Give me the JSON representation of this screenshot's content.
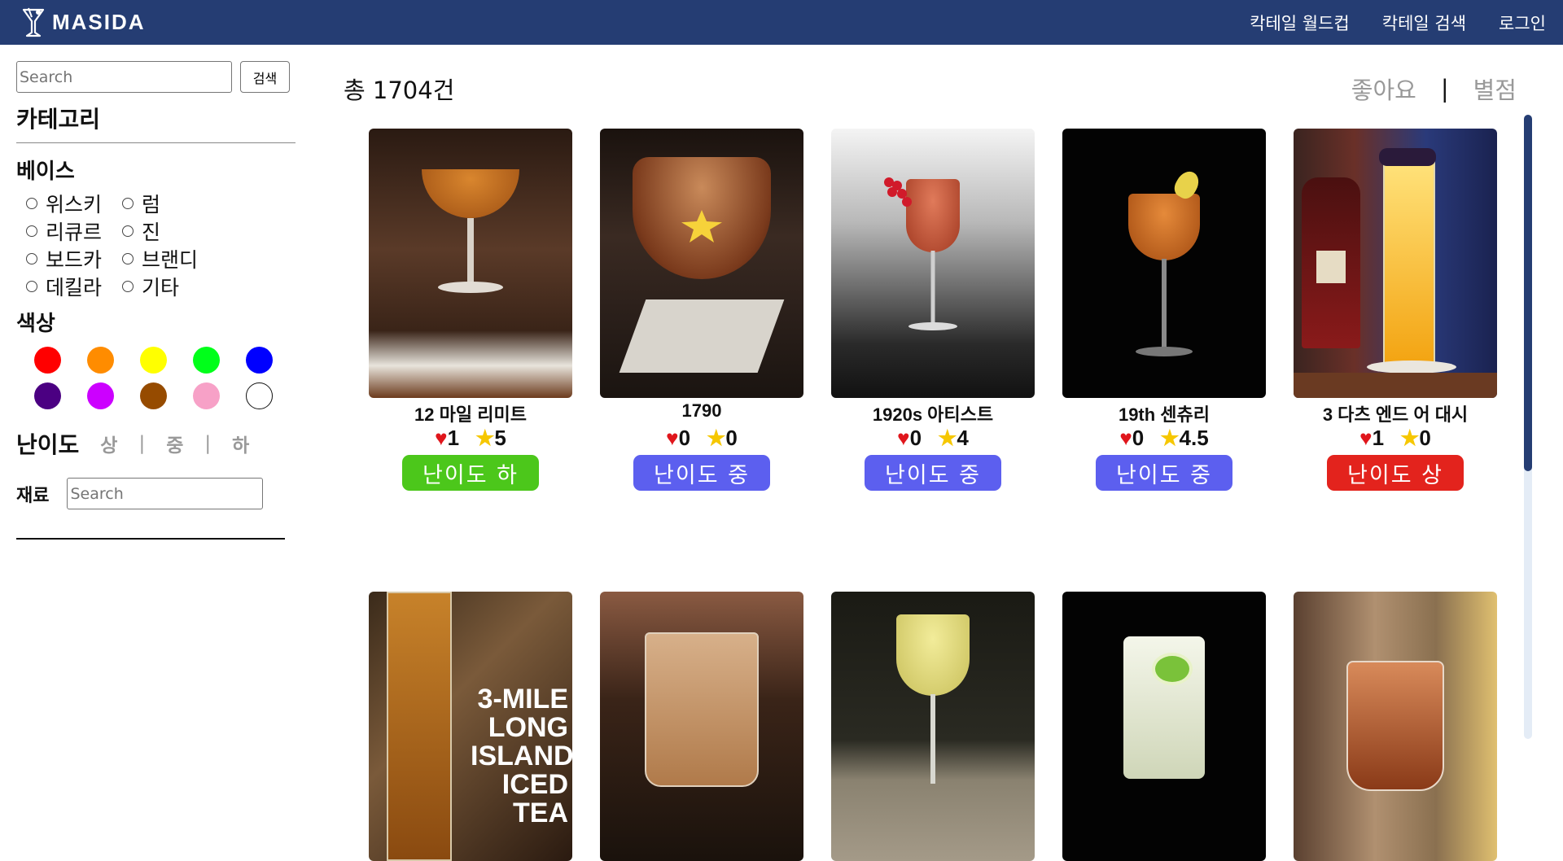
{
  "header": {
    "logo_text": "MASIDA",
    "nav": [
      "칵테일 월드컵",
      "칵테일 검색",
      "로그인"
    ]
  },
  "sidebar": {
    "search_placeholder": "Search",
    "search_button": "검색",
    "category_title": "카테고리",
    "base_title": "베이스",
    "bases": [
      "위스키",
      "럼",
      "리큐르",
      "진",
      "보드카",
      "브랜디",
      "데킬라",
      "기타"
    ],
    "color_title": "색상",
    "colors": [
      "#ff0000",
      "#ff8c00",
      "#ffff00",
      "#00ff1a",
      "#0000ff",
      "#4b0082",
      "#cc00ff",
      "#964b00",
      "#f7a1c7",
      "#ffffff"
    ],
    "difficulty_title": "난이도",
    "difficulty_options": [
      "상",
      "중",
      "하"
    ],
    "difficulty_sep": "|",
    "ingredient_label": "재료",
    "ingredient_placeholder": "Search"
  },
  "main": {
    "total_text": "총 1704건",
    "sort_options": [
      "좋아요",
      "별점"
    ],
    "sort_sep": "|",
    "cards": [
      {
        "name": "12 마일 리미트",
        "likes": "1",
        "rating": "5",
        "difficulty": "난이도 하",
        "difficulty_color": "#4cc71b"
      },
      {
        "name": "1790",
        "likes": "0",
        "rating": "0",
        "difficulty": "난이도 중",
        "difficulty_color": "#5c5fef"
      },
      {
        "name": "1920s 아티스트",
        "likes": "0",
        "rating": "4",
        "difficulty": "난이도 중",
        "difficulty_color": "#5c5fef"
      },
      {
        "name": "19th 센츄리",
        "likes": "0",
        "rating": "4.5",
        "difficulty": "난이도 중",
        "difficulty_color": "#5c5fef"
      },
      {
        "name": "3 다츠 엔드 어 대시",
        "likes": "1",
        "rating": "0",
        "difficulty": "난이도 상",
        "difficulty_color": "#e3231d"
      }
    ],
    "second_row_overlay_text": [
      "3-MILE",
      "LONG",
      "ISLAND",
      "ICED",
      "TEA"
    ]
  }
}
